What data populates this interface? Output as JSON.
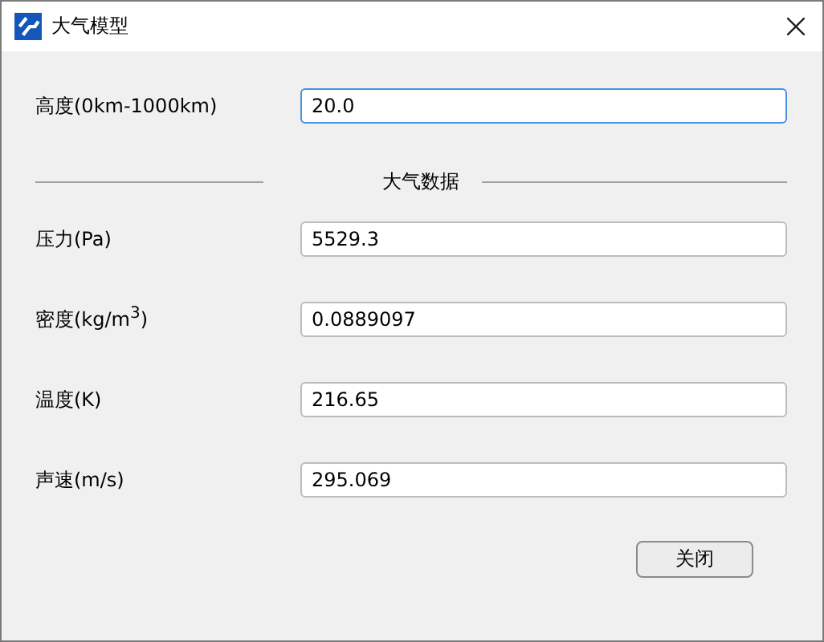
{
  "window": {
    "title": "大气模型"
  },
  "input": {
    "label": "高度(0km-1000km)",
    "value": "20.0",
    "focused": true
  },
  "section": {
    "title": "大气数据"
  },
  "outputs": [
    {
      "label": "压力(Pa)",
      "value": "5529.3",
      "focused": false
    },
    {
      "label": "密度(kg/m$^{3}$)",
      "value": "0.0889097",
      "focused": false
    },
    {
      "label": "温度(K)",
      "value": "216.65",
      "focused": false
    },
    {
      "label": "声速(m/s)",
      "value": "295.069",
      "focused": false
    }
  ],
  "buttons": [
    "关闭"
  ]
}
